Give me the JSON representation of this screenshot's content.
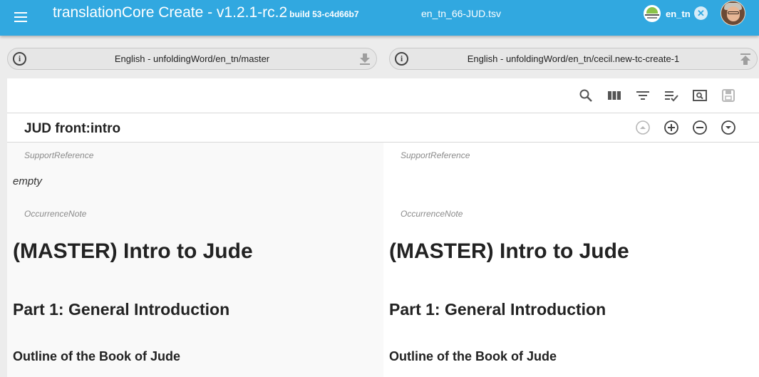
{
  "app_bar": {
    "title": "translationCore Create - v1.2.1-rc.2",
    "build": "build 53-c4d66b7",
    "file_name": "en_tn_66-JUD.tsv",
    "organization": "en_tn",
    "menu_icon": "hamburger-menu-icon",
    "clear_icon": "close-circle-icon",
    "avatar": "user-avatar"
  },
  "resources": {
    "left": {
      "label": "English - unfoldingWord/en_tn/master",
      "action_icon": "download-icon"
    },
    "right": {
      "label": "English - unfoldingWord/en_tn/cecil.new-tc-create-1",
      "action_icon": "publish-icon"
    }
  },
  "toolbar": {
    "icons": [
      "search-icon",
      "columns-icon",
      "filter-icon",
      "validate-list-icon",
      "preview-icon",
      "save-icon"
    ]
  },
  "row": {
    "title": "JUD front:intro",
    "icons": [
      "move-up-icon",
      "add-row-icon",
      "remove-row-icon",
      "move-down-icon"
    ]
  },
  "source": {
    "support_reference_label": "SupportReference",
    "support_reference_value": "empty",
    "occurrence_note_label": "OccurrenceNote",
    "heading1": "(MASTER) Intro to Jude",
    "heading2": "Part 1: General Introduction",
    "heading3": "Outline of the Book of Jude"
  },
  "target": {
    "support_reference_label": "SupportReference",
    "occurrence_note_label": "OccurrenceNote",
    "heading1": "(MASTER) Intro to Jude",
    "heading2": "Part 1: General Introduction",
    "heading3": "Outline of the Book of Jude"
  },
  "colors": {
    "app_bar": "#31a8e0",
    "source_background": "#f9f9f9",
    "target_background": "#ffffff",
    "icon": "#555555",
    "disabled_icon": "#b8b8b8"
  }
}
